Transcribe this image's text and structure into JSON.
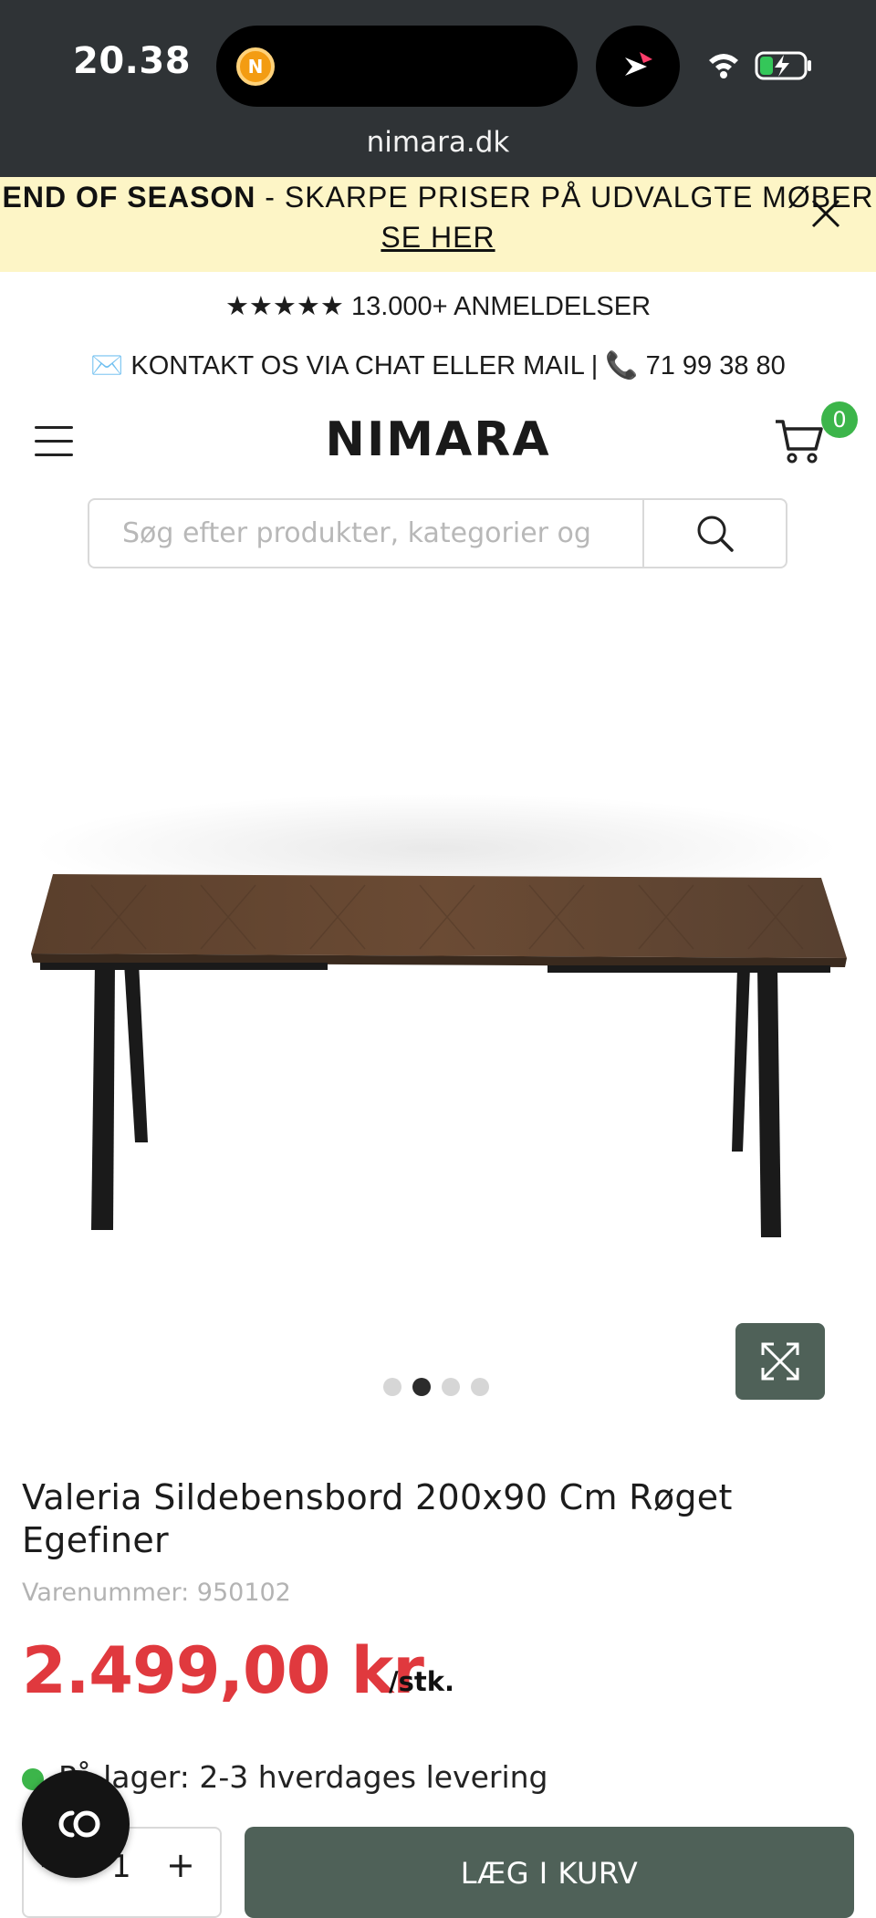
{
  "status_bar": {
    "time": "20.38",
    "url": "nimara.dk"
  },
  "promo": {
    "bold": "END OF SEASON",
    "text": " - SKARPE PRISER PÅ UDVALGTE MØBER",
    "link": "SE HER"
  },
  "reviews": "★★★★★ 13.000+ ANMELDELSER",
  "contact": "✉️ KONTAKT OS VIA CHAT ELLER MAIL | 📞 71 99 38 80",
  "header": {
    "logo": "NIMARA",
    "cart_count": "0"
  },
  "search": {
    "placeholder": "Søg efter produkter, kategorier og"
  },
  "product": {
    "title": "Valeria Sildebensbord 200x90 Cm Røget Egefiner",
    "sku": "Varenummer: 950102",
    "price": "2.499,00 kr",
    "unit": "/stk.",
    "stock": "På lager: 2-3 hverdages levering",
    "quantity": "1",
    "add_to_cart": "LÆG I KURV",
    "image_count": 4,
    "active_image": 2
  },
  "colors": {
    "accent_green": "#4f6158",
    "price_red": "#e0393e",
    "promo_bg": "#fdf5c6",
    "stock_green": "#3cb54a"
  },
  "icons": [
    "coin-icon",
    "app-icon",
    "wifi-icon",
    "battery-icon",
    "close-icon",
    "menu-icon",
    "cart-icon",
    "search-icon",
    "expand-icon",
    "chat-icon"
  ]
}
